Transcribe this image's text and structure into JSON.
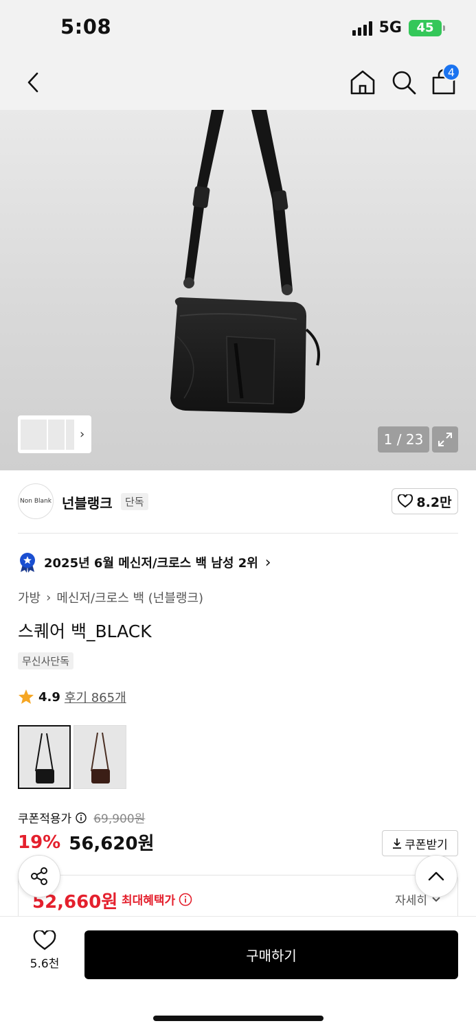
{
  "status_bar": {
    "time": "5:08",
    "network": "5G",
    "battery": "45"
  },
  "nav": {
    "cart_count": "4"
  },
  "gallery": {
    "counter": "1 / 23"
  },
  "brand": {
    "logo_text": "Non Blank",
    "name": "넌블랭크",
    "badge": "단독",
    "likes": "8.2만"
  },
  "ranking": {
    "text": "2025년 6월 메신저/크로스 백 남성 2위"
  },
  "breadcrumb": {
    "category": "가방",
    "subcategory": "메신저/크로스 백 (넌블랭크)"
  },
  "product": {
    "title": "스퀘어 백_BLACK",
    "tag": "무신사단독",
    "rating": "4.9",
    "reviews": "후기 865개"
  },
  "pricing": {
    "coupon_label": "쿠폰적용가",
    "original_price": "69,900원",
    "discount": "19%",
    "price": "56,620원",
    "coupon_button": "쿠폰받기",
    "max_benefit_price": "52,660원",
    "max_benefit_label": "최대혜택가",
    "detail_link": "자세히"
  },
  "bottom": {
    "wish_count": "5.6천",
    "buy_label": "구매하기"
  },
  "colors": {
    "accent_red": "#e4202d",
    "badge_blue": "#1a73f0",
    "star": "#f5a623"
  }
}
